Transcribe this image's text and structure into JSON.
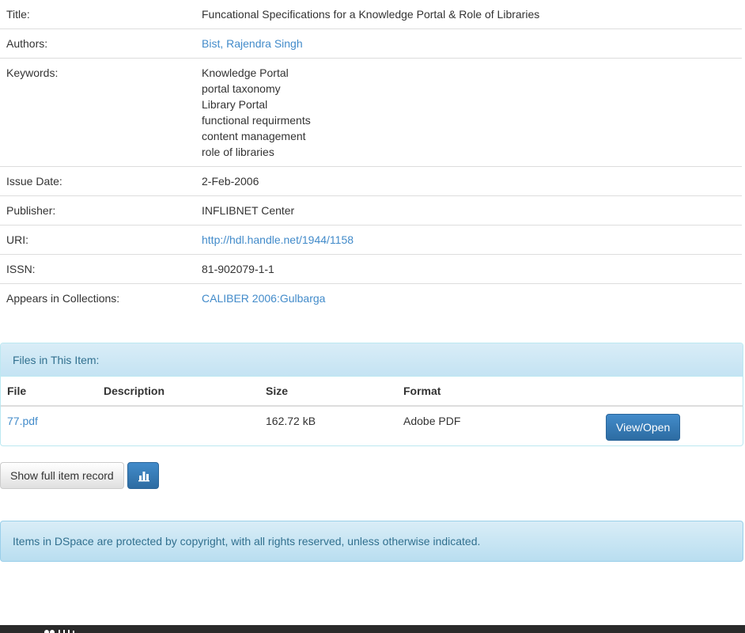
{
  "metadata": {
    "title_label": "Title:",
    "title_value": "Funcational Specifications for a Knowledge Portal & Role of Libraries",
    "authors_label": "Authors:",
    "authors_value": "Bist, Rajendra Singh",
    "keywords_label": "Keywords:",
    "keywords": [
      "Knowledge Portal",
      "portal taxonomy",
      "Library Portal",
      "functional requirments",
      "content management",
      "role of libraries"
    ],
    "issue_date_label": "Issue Date:",
    "issue_date_value": "2-Feb-2006",
    "publisher_label": "Publisher:",
    "publisher_value": "INFLIBNET Center",
    "uri_label": "URI:",
    "uri_value": "http://hdl.handle.net/1944/1158",
    "issn_label": "ISSN:",
    "issn_value": "81-902079-1-1",
    "collections_label": "Appears in Collections:",
    "collections_value": "CALIBER 2006:Gulbarga"
  },
  "files": {
    "heading": "Files in This Item:",
    "columns": [
      "File",
      "Description",
      "Size",
      "Format"
    ],
    "rows": [
      {
        "file": "77.pdf",
        "description": "",
        "size": "162.72 kB",
        "format": "Adobe PDF",
        "action_label": "View/Open"
      }
    ]
  },
  "actions": {
    "full_record_label": "Show full item record",
    "stats_icon": "bar-chart-icon"
  },
  "notice": {
    "copyright_text": "Items in DSpace are protected by copyright, with all rights reserved, unless otherwise indicated."
  },
  "colors": {
    "link": "#428bca",
    "primary_button": "#428bca",
    "info_text": "#31708f",
    "info_background": "#d9edf7",
    "footer": "#2a2a2a"
  }
}
